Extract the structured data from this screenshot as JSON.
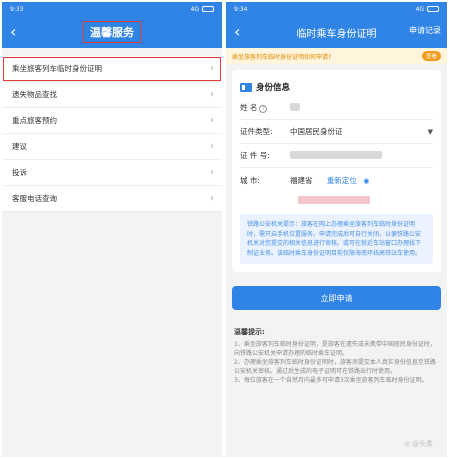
{
  "left": {
    "status": {
      "time": "9:33",
      "signal": "4G"
    },
    "title": "温馨服务",
    "menu": [
      {
        "label": "乘坐旅客列车临时身份证明",
        "highlight": true
      },
      {
        "label": "遗失物品查找",
        "highlight": false
      },
      {
        "label": "重点旅客预约",
        "highlight": false
      },
      {
        "label": "建议",
        "highlight": false
      },
      {
        "label": "投诉",
        "highlight": false
      },
      {
        "label": "客服电话查询",
        "highlight": false
      }
    ]
  },
  "right": {
    "status": {
      "time": "9:34",
      "signal": "4G"
    },
    "title": "临时乘车身份证明",
    "action": "申请记录",
    "notice": {
      "text": "乘坐旅客列车临时身份证明如何申请?",
      "button": "查看"
    },
    "card_title": "身份信息",
    "fields": {
      "name_label": "姓  名",
      "id_type_label": "证件类型:",
      "id_type_value": "中国居民身份证",
      "id_no_label": "证 件 号:",
      "city_label": "城    市:",
      "city_value": "福建省",
      "relocate": "重新定位"
    },
    "police_tip": "铁路公安机关提示：旅客在网上办理乘坐旅客列车临时身份证明时，需开启手机位置服务。申请完成后可自行关闭。以便铁路公安机关对您提交的相关信息进行审核。或可在就近车站窗口办理线下制证业务。该临时乘车身份证明目前仅限海南环线高铁站车使用。",
    "submit": "立即申请",
    "tips_title": "温馨提示:",
    "tips": [
      "1、乘坐旅客列车临时身份证明，是旅客在遗失或未携带中国居民身份证时，向铁路公安机关申请办理的临时乘车证明。",
      "2、办理乘坐旅客列车临时身份证明时，旅客须提交本人真实身份信息至铁路公安机关审核。通过后生成的电子证明可在铁路出行时使用。",
      "3、每位旅客在一个自然月内最多可申请3次乘坐旅客列车临时身份证明。"
    ],
    "watermark": "@头条"
  }
}
